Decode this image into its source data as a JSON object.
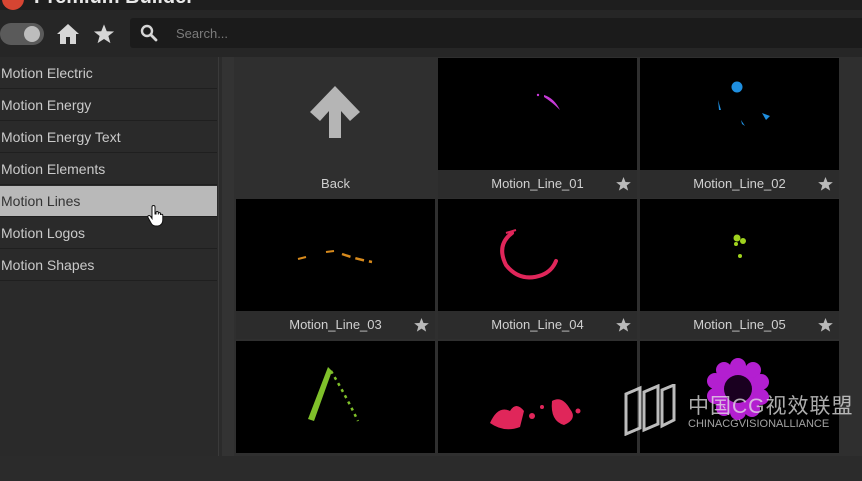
{
  "app": {
    "title": "Premium Builder"
  },
  "search": {
    "placeholder": "Search..."
  },
  "sidebar": {
    "items": [
      {
        "label": "Motion Electric",
        "active": false
      },
      {
        "label": "Motion Energy",
        "active": false
      },
      {
        "label": "Motion Energy Text",
        "active": false
      },
      {
        "label": "Motion Elements",
        "active": false
      },
      {
        "label": "Motion Lines",
        "active": true
      },
      {
        "label": "Motion Logos",
        "active": false
      },
      {
        "label": "Motion Shapes",
        "active": false
      }
    ]
  },
  "grid": {
    "tiles": [
      {
        "label": "Back"
      },
      {
        "label": "Motion_Line_01"
      },
      {
        "label": "Motion_Line_02"
      },
      {
        "label": "Motion_Line_03"
      },
      {
        "label": "Motion_Line_04"
      },
      {
        "label": "Motion_Line_05"
      },
      {
        "label": ""
      },
      {
        "label": ""
      },
      {
        "label": ""
      }
    ]
  },
  "watermark": {
    "cn": "中国CG视效联盟",
    "en": "CHINACGVISIONALLIANCE"
  },
  "colors": {
    "accent_magenta": "#c83ad8",
    "accent_blue": "#1f8fe0",
    "accent_orange": "#d88a1c",
    "accent_red": "#e0265a",
    "accent_lime": "#9fd21e",
    "accent_green": "#7fc02a",
    "accent_purple": "#b31fd0"
  }
}
